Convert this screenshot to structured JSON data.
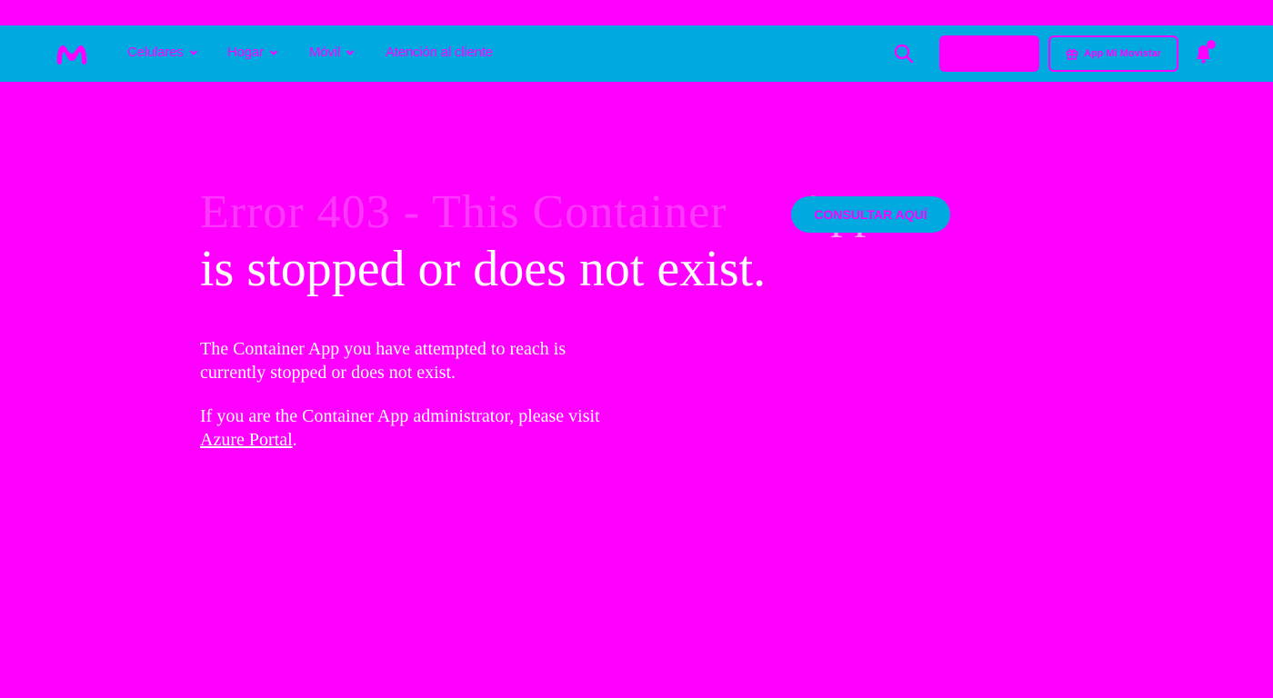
{
  "nav": {
    "items": [
      {
        "label": "Celulares",
        "has_dropdown": true
      },
      {
        "label": "Hogar",
        "has_dropdown": true
      },
      {
        "label": "Móvil",
        "has_dropdown": true
      },
      {
        "label": "Atención al cliente",
        "has_dropdown": false
      }
    ],
    "app_button_label": "App Mi Movistar",
    "icons": {
      "logo": "movistar-logo-icon",
      "search": "search-icon",
      "gift": "gift-icon",
      "bell": "bell-icon"
    }
  },
  "hero": {
    "headline_ghost": "Error 403 - This Container",
    "app_word": "App",
    "consult_button_label": "CONSULTAR AQUÍ",
    "headline": "is stopped or does not exist.",
    "paragraph_1": "The Container App you have attempted to reach is currently stopped or does not exist.",
    "paragraph_2_prefix": "If you are the Container App administrator, please visit ",
    "paragraph_2_link": "Azure Portal",
    "paragraph_2_suffix": "."
  },
  "colors": {
    "background": "#ff00ff",
    "navbar": "#00a9e0",
    "accent": "#ff00ff",
    "text_light": "#ffffff"
  }
}
